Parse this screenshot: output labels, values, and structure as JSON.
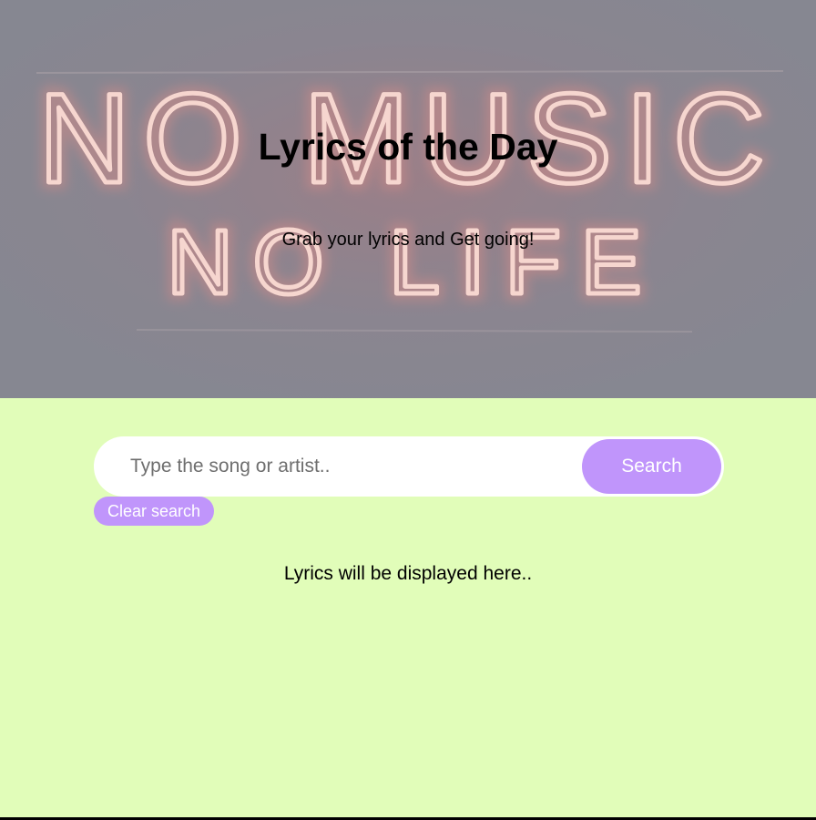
{
  "header": {
    "title": "Lyrics of the Day",
    "subtitle": "Grab your lyrics and Get going!",
    "background_sign_text": [
      "NO MUSIC",
      "NO LIFE"
    ]
  },
  "search": {
    "placeholder": "Type the song or artist..",
    "value": "",
    "button_label": "Search",
    "clear_label": "Clear search"
  },
  "lyrics": {
    "placeholder_text": "Lyrics will be displayed here.."
  },
  "colors": {
    "page_background": "#e1fdb9",
    "hero_overlay": "#868791",
    "accent": "#c095fb",
    "neon": "#f4c9c4"
  }
}
